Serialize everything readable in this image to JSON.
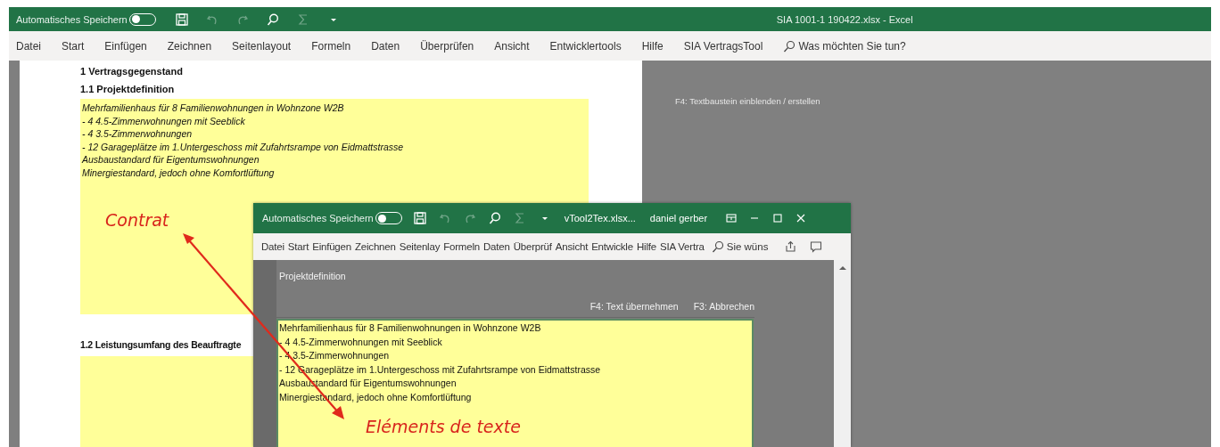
{
  "window": {
    "autosave": {
      "label": "Automatisches Speichern",
      "on": false
    },
    "quick_access": [
      {
        "kind": "save",
        "disabled": false
      },
      {
        "kind": "undo",
        "disabled": true
      },
      {
        "kind": "redo",
        "disabled": true
      },
      {
        "kind": "search",
        "disabled": false
      },
      {
        "kind": "sum",
        "disabled": true
      },
      {
        "kind": "customize",
        "disabled": false
      }
    ],
    "title": "SIA 1001-1 190422.xlsx  -  Excel"
  },
  "ribbon_tabs": [
    "Datei",
    "Start",
    "Einfügen",
    "Zeichnen",
    "Seitenlayout",
    "Formeln",
    "Daten",
    "Überprüfen",
    "Ansicht",
    "Entwicklertools",
    "Hilfe",
    "SIA VertragsTool"
  ],
  "tell_me": {
    "placeholder": "Was möchten Sie tun?"
  },
  "sheet": {
    "heading": "1 Vertragsgegenstand",
    "subheading": "1.1 Projektdefinition",
    "lines": [
      "Mehrfamilienhaus für 8 Familienwohnungen in Wohnzone W2B",
      "- 4 4.5-Zimmerwohnungen mit Seeblick",
      "- 4 3.5-Zimmerwohnungen",
      "- 12 Garageplätze im 1.Untergeschoss mit Zufahrtsrampe von Eidmattstrasse",
      "Ausbaustandard für Eigentumswohnungen",
      "Minergiestandard, jedoch ohne Komfortlüftung"
    ],
    "next_heading": "1.2 Leistungsumfang des Beauftragte"
  },
  "side_hint": "F4: Textbaustein einblenden / erstellen",
  "dialog_window": {
    "autosave": {
      "label": "Automatisches Speichern",
      "on": false
    },
    "quick_access": [
      {
        "kind": "save",
        "disabled": false
      },
      {
        "kind": "undo",
        "disabled": true
      },
      {
        "kind": "redo",
        "disabled": true
      },
      {
        "kind": "search",
        "disabled": false
      },
      {
        "kind": "sum",
        "disabled": true
      },
      {
        "kind": "customize",
        "disabled": false
      }
    ],
    "title": "vTool2Tex.xlsx...",
    "user": "daniel gerber",
    "ribbon_tabs": [
      "Datei",
      "Start",
      "Einfügen",
      "Zeichnen",
      "Seitenlay",
      "Formeln",
      "Daten",
      "Überprüf",
      "Ansicht",
      "Entwickle",
      "Hilfe",
      "SIA Vertra"
    ],
    "tell_me": {
      "placeholder": "Sie wüns"
    },
    "sheet": {
      "title": "Projektdefinition",
      "shortcuts": [
        "F4: Text übernehmen",
        "F3: Abbrechen"
      ],
      "lines": [
        "Mehrfamilienhaus für 8 Familienwohnungen in Wohnzone W2B",
        "- 4 4.5-Zimmerwohnungen mit Seeblick",
        "- 4 3.5-Zimmerwohnungen",
        "- 12 Garageplätze im 1.Untergeschoss mit Zufahrtsrampe von Eidmattstrasse",
        "Ausbaustandard für Eigentumswohnungen",
        "Minergiestandard, jedoch ohne Komfortlüftung"
      ]
    }
  },
  "annotations": [
    {
      "text": "Contrat"
    },
    {
      "text": "Eléments de texte"
    }
  ]
}
